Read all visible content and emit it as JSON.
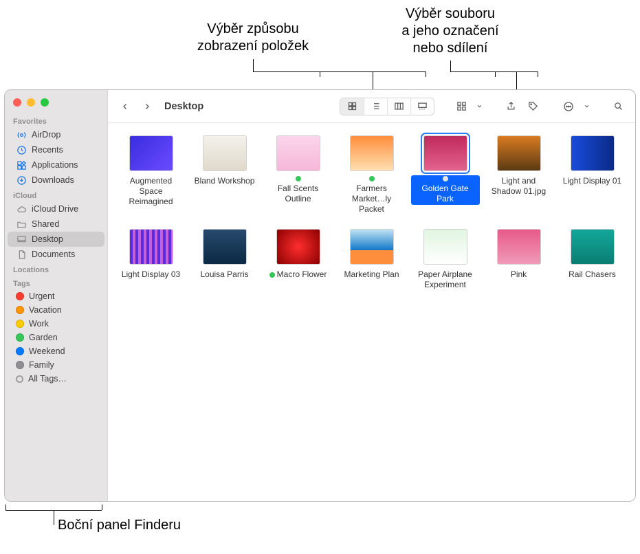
{
  "callouts": {
    "view": "Výběr způsobu\nzobrazení položek",
    "share": "Výběr souboru\na jeho označení\nnebo sdílení",
    "sidebar": "Boční panel Finderu"
  },
  "window": {
    "title": "Desktop"
  },
  "sidebar": {
    "sections": {
      "favorites": {
        "label": "Favorites",
        "items": [
          {
            "icon": "airdrop",
            "label": "AirDrop"
          },
          {
            "icon": "recents",
            "label": "Recents"
          },
          {
            "icon": "apps",
            "label": "Applications"
          },
          {
            "icon": "downloads",
            "label": "Downloads"
          }
        ]
      },
      "icloud": {
        "label": "iCloud",
        "items": [
          {
            "icon": "cloud",
            "label": "iCloud Drive"
          },
          {
            "icon": "shared",
            "label": "Shared"
          },
          {
            "icon": "desktop",
            "label": "Desktop",
            "selected": true
          },
          {
            "icon": "doc",
            "label": "Documents"
          }
        ]
      },
      "locations": {
        "label": "Locations",
        "items": []
      },
      "tags": {
        "label": "Tags",
        "items": [
          {
            "color": "#ff3b30",
            "label": "Urgent"
          },
          {
            "color": "#ff9500",
            "label": "Vacation"
          },
          {
            "color": "#ffcc00",
            "label": "Work"
          },
          {
            "color": "#34c759",
            "label": "Garden"
          },
          {
            "color": "#007aff",
            "label": "Weekend"
          },
          {
            "color": "#8e8e93",
            "label": "Family"
          },
          {
            "hollow": true,
            "label": "All Tags…"
          }
        ]
      }
    }
  },
  "files": [
    {
      "name": "Augmented Space Reimagined",
      "thumb": "linear-gradient(135deg,#3a2de0,#6b4bff)"
    },
    {
      "name": "Bland Workshop",
      "thumb": "linear-gradient(#f4f1ea,#e0dacc)"
    },
    {
      "name": "Fall Scents Outline",
      "thumb": "linear-gradient(#fbd5ec,#f6b7d8)",
      "tag": "#34c759"
    },
    {
      "name": "Farmers Market…ly Packet",
      "thumb": "linear-gradient(#ff8e3c,#ffe0b2)",
      "tag": "#34c759"
    },
    {
      "name": "Golden Gate Park",
      "thumb": "linear-gradient(#c02a5c,#e4638f)",
      "tag": "#e4e4e4",
      "selected": true
    },
    {
      "name": "Light and Shadow 01.jpg",
      "thumb": "linear-gradient(#d97b22,#5b3a12)"
    },
    {
      "name": "Light Display 01",
      "thumb": "linear-gradient(90deg,#1a4bdc,#0a2a88)"
    },
    {
      "name": "Light Display 03",
      "thumb": "repeating-linear-gradient(90deg,#5b2bd9 0 4px,#c75fd6 4px 8px)"
    },
    {
      "name": "Louisa Parris",
      "thumb": "linear-gradient(#27496d,#0c2a44)"
    },
    {
      "name": "Macro Flower",
      "thumb": "radial-gradient(circle,#ff2e2e,#8b0000)",
      "tag": "#34c759"
    },
    {
      "name": "Marketing Plan",
      "thumb": "linear-gradient(#bfe3f5,#1177c8 60%,#ff8e3c 60%)"
    },
    {
      "name": "Paper Airplane Experiment",
      "thumb": "linear-gradient(#e0f5e0,#ffffff)"
    },
    {
      "name": "Pink",
      "thumb": "linear-gradient(#e75a8a,#f09ab8)"
    },
    {
      "name": "Rail Chasers",
      "thumb": "linear-gradient(#12a89a,#0b7d73)"
    }
  ]
}
